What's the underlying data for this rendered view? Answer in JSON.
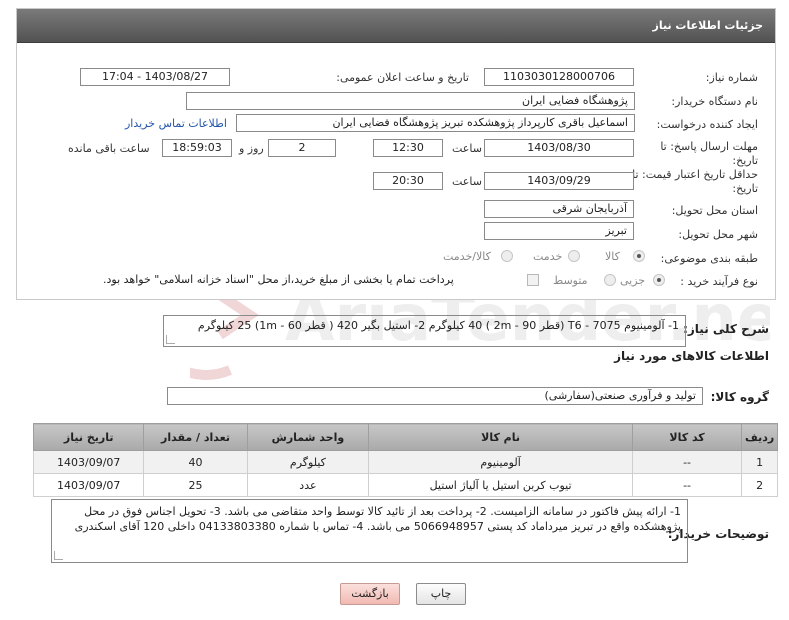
{
  "header": {
    "title": "جزئیات اطلاعات نیاز"
  },
  "form": {
    "need_number_label": "شماره نیاز:",
    "need_number": "1103030128000706",
    "announce_label": "تاریخ و ساعت اعلان عمومی:",
    "announce_value": "1403/08/27 - 17:04",
    "buyer_org_label": "نام دستگاه خریدار:",
    "buyer_org": "پژوهشگاه فضایی ایران",
    "creator_label": "ایجاد کننده درخواست:",
    "creator": "اسماعیل باقری کارپرداز پژوهشکده تبریز پژوهشگاه فضایی ایران",
    "contact_link": "اطلاعات تماس خریدار",
    "deadline_label": "مهلت ارسال پاسخ: تا تاریخ:",
    "deadline_date": "1403/08/30",
    "time_word": "ساعت",
    "deadline_time": "12:30",
    "days_count": "2",
    "days_word": "روز و",
    "remaining_time": "18:59:03",
    "remaining_word": "ساعت باقی مانده",
    "validity_label": "حداقل تاریخ اعتبار قیمت: تا تاریخ:",
    "validity_date": "1403/09/29",
    "validity_time": "20:30",
    "province_label": "استان محل تحویل:",
    "province": "آذربایجان شرقی",
    "city_label": "شهر محل تحویل:",
    "city": "تبریز",
    "category_label": "طبقه بندی موضوعی:",
    "category_options": [
      "کالا",
      "خدمت",
      "کالا/خدمت"
    ],
    "process_label": "نوع فرآیند خرید :",
    "process_options": [
      "جزیی",
      "متوسط"
    ],
    "payment_note": "پرداخت تمام یا بخشی از مبلغ خرید،از محل \"اسناد خزانه اسلامی\" خواهد بود."
  },
  "description": {
    "label": "شرح کلی نیاز:",
    "text": "1- آلومینیوم T6 - 7075 (قطر 90 - 2m ) 40 کیلوگرم  2- استیل بگیر 420 ( قطر 60 - 1m) 25 کیلوگرم"
  },
  "goods_info_title": "اطلاعات کالاهای مورد نیاز",
  "goods_group": {
    "label": "گروه کالا:",
    "value": "تولید و فرآوری صنعتی(سفارشی)"
  },
  "table": {
    "headers": [
      "ردیف",
      "کد کالا",
      "نام کالا",
      "واحد شمارش",
      "تعداد / مقدار",
      "تاریخ نیاز"
    ],
    "rows": [
      [
        "1",
        "--",
        "آلومینیوم",
        "کیلوگرم",
        "40",
        "1403/09/07"
      ],
      [
        "2",
        "--",
        "تیوب کربن استیل یا آلیاژ استیل",
        "عدد",
        "25",
        "1403/09/07"
      ]
    ]
  },
  "buyer_notes": {
    "label": "توضیحات خریدار:",
    "text": "1- ارائه پیش فاکتور در سامانه الزامیست. 2- پرداخت بعد از تائید کالا توسط واحد متقاضی می باشد. 3- تحویل اجناس فوق در محل پژوهشکده واقع در تبریز میرداماد کد پستی 5066948957 می باشد. 4- تماس با شماره 04133803380 داخلی 120 آقای اسکندری"
  },
  "buttons": {
    "print": "چاپ",
    "back": "بازگشت"
  },
  "watermark_text": "AriaTender.neT",
  "colors": {
    "header": "#5e5e5e",
    "link": "#2255aa",
    "back_button": "#f6c9c4"
  }
}
